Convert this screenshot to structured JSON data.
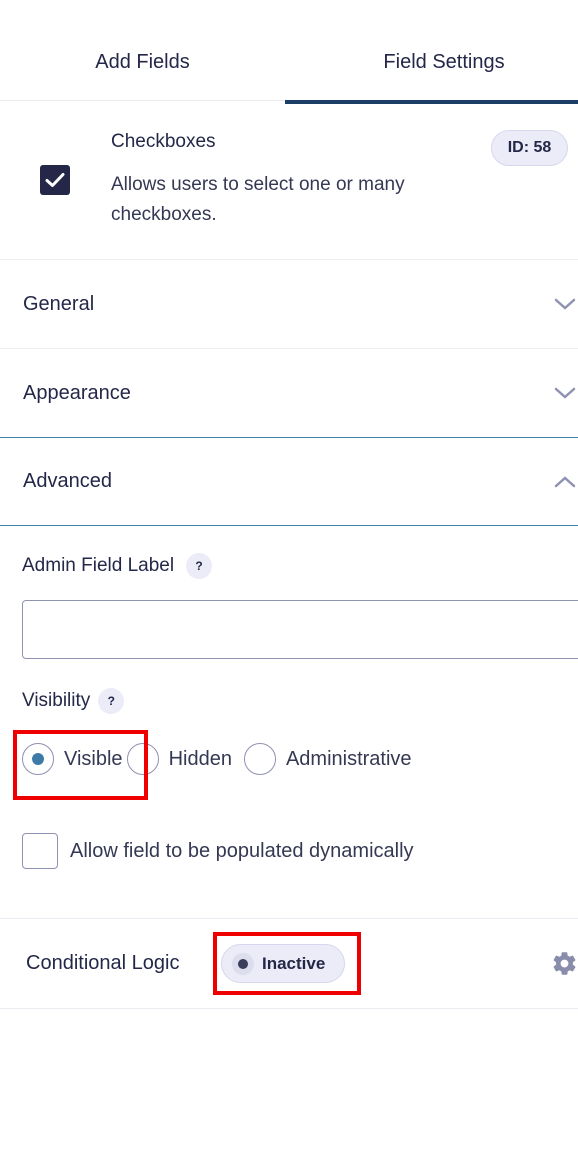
{
  "tabs": [
    {
      "label": "Add Fields",
      "active": false
    },
    {
      "label": "Field Settings",
      "active": true
    }
  ],
  "field": {
    "title": "Checkboxes",
    "description": "Allows users to select one or many checkboxes.",
    "id_badge": "ID: 58",
    "icon": "checkbox-checked-icon"
  },
  "sections": [
    {
      "label": "General",
      "expanded": false,
      "icon": "chevron-down-icon"
    },
    {
      "label": "Appearance",
      "expanded": false,
      "icon": "chevron-down-icon"
    },
    {
      "label": "Advanced",
      "expanded": true,
      "icon": "chevron-up-icon"
    }
  ],
  "advanced": {
    "admin_field_label": {
      "label": "Admin Field Label",
      "help": "?",
      "value": "",
      "placeholder": ""
    },
    "visibility": {
      "label": "Visibility",
      "help": "?",
      "options": [
        {
          "label": "Visible",
          "selected": true
        },
        {
          "label": "Hidden",
          "selected": false
        },
        {
          "label": "Administrative",
          "selected": false
        }
      ]
    },
    "dynamic_population": {
      "label": "Allow field to be populated dynamically",
      "checked": false
    }
  },
  "conditional_logic": {
    "label": "Conditional Logic",
    "status": "Inactive",
    "icon": "gear-icon"
  },
  "colors": {
    "primary_text": "#242748",
    "active_tab_bar": "#1a3e66",
    "radio_selected": "#3e7aa8",
    "badge_bg": "#ececf8",
    "highlight": "#ee0000"
  }
}
